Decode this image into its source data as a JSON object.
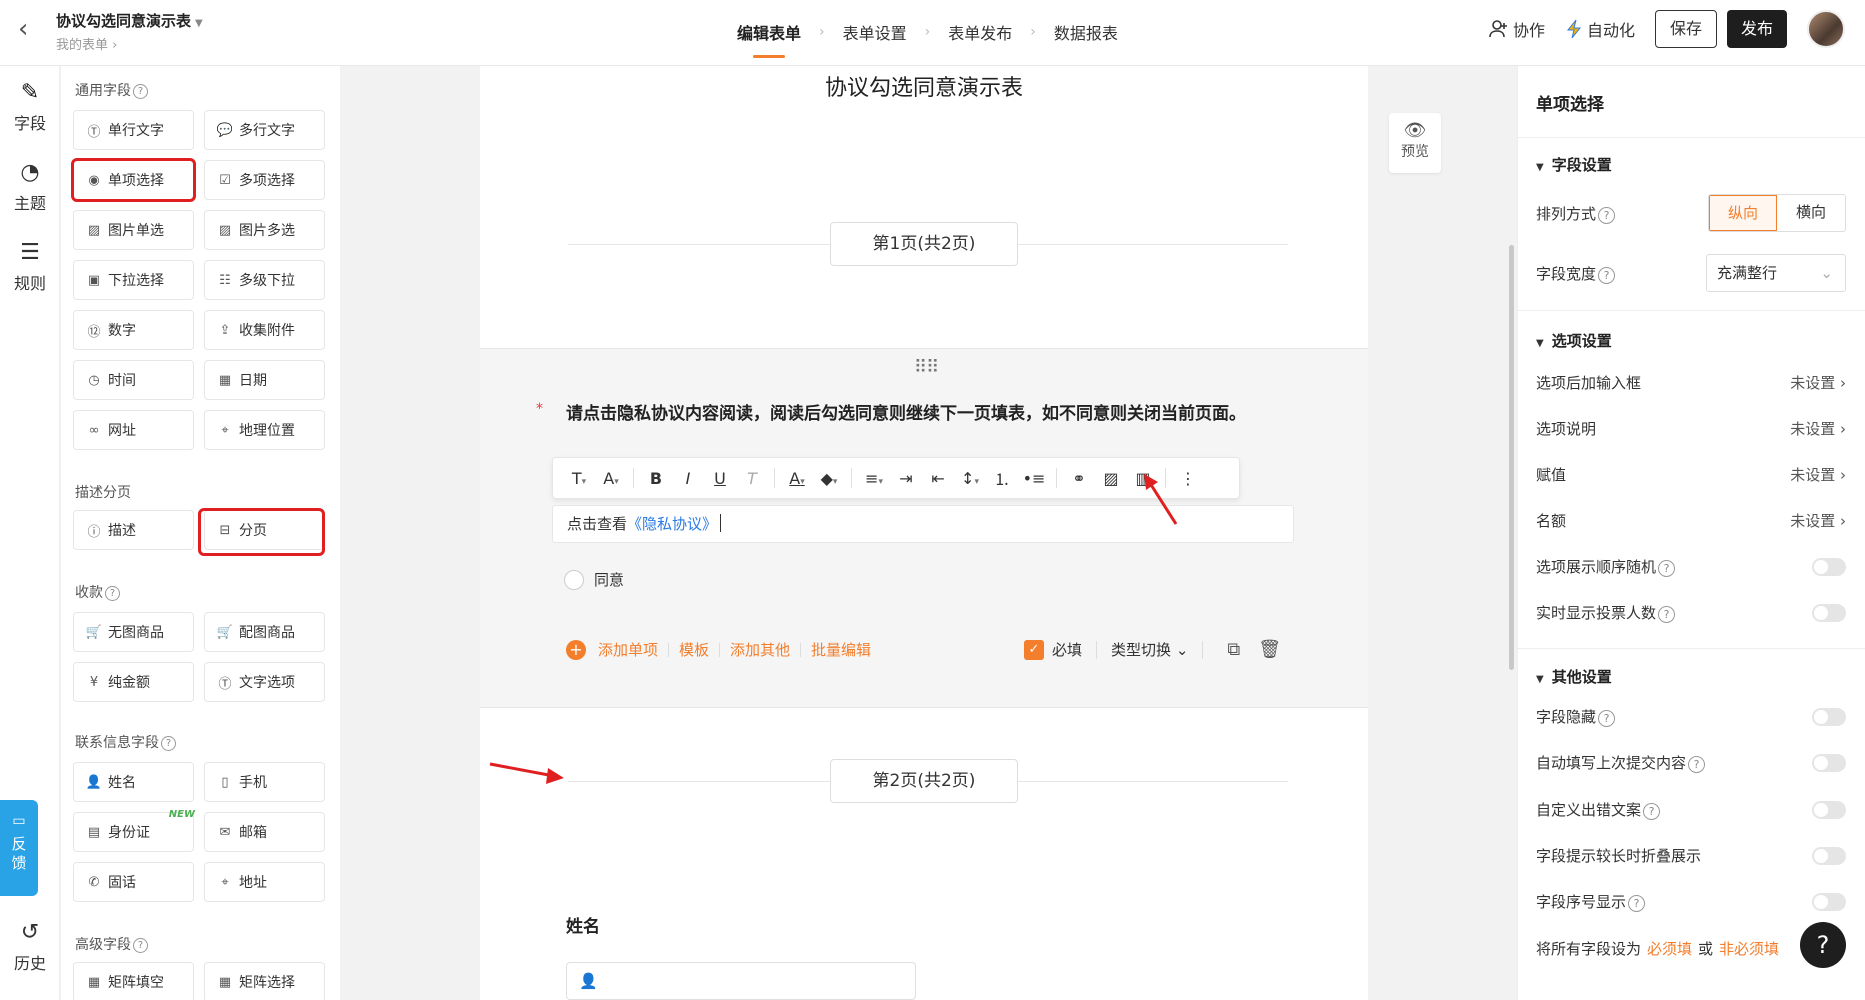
{
  "header": {
    "back_icon": "chevron-left-icon",
    "form_title": "协议勾选同意演示表",
    "breadcrumb": "我的表单",
    "steps": [
      "编辑表单",
      "表单设置",
      "表单发布",
      "数据报表"
    ],
    "collab": "协作",
    "automation": "自动化",
    "save": "保存",
    "publish": "发布"
  },
  "rail": {
    "items": [
      {
        "label": "字段",
        "icon": "edit-icon"
      },
      {
        "label": "主题",
        "icon": "palette-icon"
      },
      {
        "label": "规则",
        "icon": "rules-icon"
      },
      {
        "label": "历史",
        "icon": "history-icon"
      }
    ],
    "feedback": "反馈"
  },
  "palette": {
    "groups": [
      {
        "title": "通用字段"
      },
      {
        "title": "描述分页"
      },
      {
        "title": "收款"
      },
      {
        "title": "联系信息字段"
      },
      {
        "title": "高级字段"
      }
    ],
    "fields": {
      "single_text": "单行文字",
      "multi_text": "多行文字",
      "single_choice": "单项选择",
      "multi_choice": "多项选择",
      "img_single": "图片单选",
      "img_multi": "图片多选",
      "dropdown": "下拉选择",
      "multi_dropdown": "多级下拉",
      "number": "数字",
      "attachment": "收集附件",
      "time": "时间",
      "date": "日期",
      "url": "网址",
      "location": "地理位置",
      "desc": "描述",
      "pagination": "分页",
      "no_img_goods": "无图商品",
      "img_goods": "配图商品",
      "pure_amount": "纯金额",
      "text_option": "文字选项",
      "name": "姓名",
      "phone": "手机",
      "id_card": "身份证",
      "email": "邮箱",
      "landline": "固话",
      "address": "地址",
      "matrix_fill": "矩阵填空",
      "matrix_select": "矩阵选择"
    },
    "new_badge": "NEW"
  },
  "canvas": {
    "title": "协议勾选同意演示表",
    "page1": "第1页(共2页)",
    "page2": "第2页(共2页)",
    "question": "请点击隐私协议内容阅读，阅读后勾选同意则继续下一页填表，如不同意则关闭当前页面。",
    "desc_prefix": "点击查看",
    "desc_link": "《隐私协议》",
    "option1": "同意",
    "add_option": "添加单项",
    "template": "模板",
    "add_other": "添加其他",
    "batch_edit": "批量编辑",
    "required": "必填",
    "type_switch": "类型切换",
    "name_label": "姓名",
    "preview": "预览"
  },
  "settings": {
    "title": "单项选择",
    "field_settings": "字段设置",
    "arrange": "排列方式",
    "arrange_options": [
      "纵向",
      "横向"
    ],
    "arrange_selected": "纵向",
    "width": "字段宽度",
    "width_value": "充满整行",
    "option_settings": "选项设置",
    "opt_input": "选项后加输入框",
    "opt_desc": "选项说明",
    "opt_value": "赋值",
    "opt_quota": "名额",
    "not_set": "未设置",
    "random_order": "选项展示顺序随机",
    "show_votes": "实时显示投票人数",
    "other_settings": "其他设置",
    "hide_field": "字段隐藏",
    "autofill": "自动填写上次提交内容",
    "custom_error": "自定义出错文案",
    "fold_hint": "字段提示较长时折叠展示",
    "show_index": "字段序号显示",
    "set_all_prefix": "将所有字段设为",
    "set_required": "必须填",
    "or": "或",
    "set_optional": "非必须填"
  },
  "colors": {
    "accent": "#f37e2c",
    "annotation": "#e02020",
    "link": "#2a7ae4",
    "feedback": "#29a3e6"
  }
}
